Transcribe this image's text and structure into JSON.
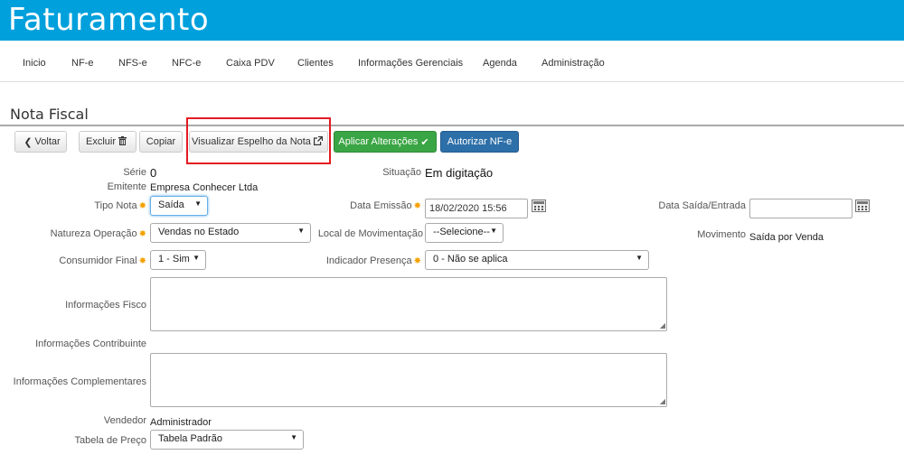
{
  "app": {
    "title": "Faturamento"
  },
  "nav": [
    "Inicio",
    "NF-e",
    "NFS-e",
    "NFC-e",
    "Caixa PDV",
    "Clientes",
    "Informações Gerenciais",
    "Agenda",
    "Administração"
  ],
  "page": {
    "title": "Nota Fiscal"
  },
  "toolbar": {
    "voltar": "Voltar",
    "excluir": "Excluir",
    "copiar": "Copiar",
    "visualizar": "Visualizar Espelho da Nota",
    "aplicar": "Aplicar Alterações",
    "autorizar": "Autorizar NF-e"
  },
  "form": {
    "serie": {
      "label": "Série",
      "value": "0"
    },
    "situacao": {
      "label": "Situação",
      "value": "Em digitação"
    },
    "emitente": {
      "label": "Emitente",
      "value": "Empresa Conhecer Ltda"
    },
    "tipo_nota": {
      "label": "Tipo Nota",
      "value": "Saída"
    },
    "data_emissao": {
      "label": "Data Emissão",
      "value": "18/02/2020 15:56"
    },
    "data_saida": {
      "label": "Data Saída/Entrada",
      "value": ""
    },
    "natureza": {
      "label": "Natureza Operação",
      "value": "Vendas no Estado"
    },
    "local_mov": {
      "label": "Local de Movimentação",
      "value": "--Selecione--"
    },
    "movimento": {
      "label": "Movimento",
      "value": "Saída por Venda"
    },
    "consumidor": {
      "label": "Consumidor Final",
      "value": "1 - Sim"
    },
    "indicador": {
      "label": "Indicador Presença",
      "value": "0 - Não se aplica"
    },
    "info_fisco": {
      "label": "Informações Fisco",
      "value": ""
    },
    "info_contribuinte": {
      "label": "Informações Contribuinte"
    },
    "info_complementares": {
      "label": "Informações Complementares",
      "value": ""
    },
    "vendedor": {
      "label": "Vendedor",
      "value": "Administrador"
    },
    "tabela_preco": {
      "label": "Tabela de Preço",
      "value": "Tabela Padrão"
    }
  },
  "required_mark": "✸"
}
